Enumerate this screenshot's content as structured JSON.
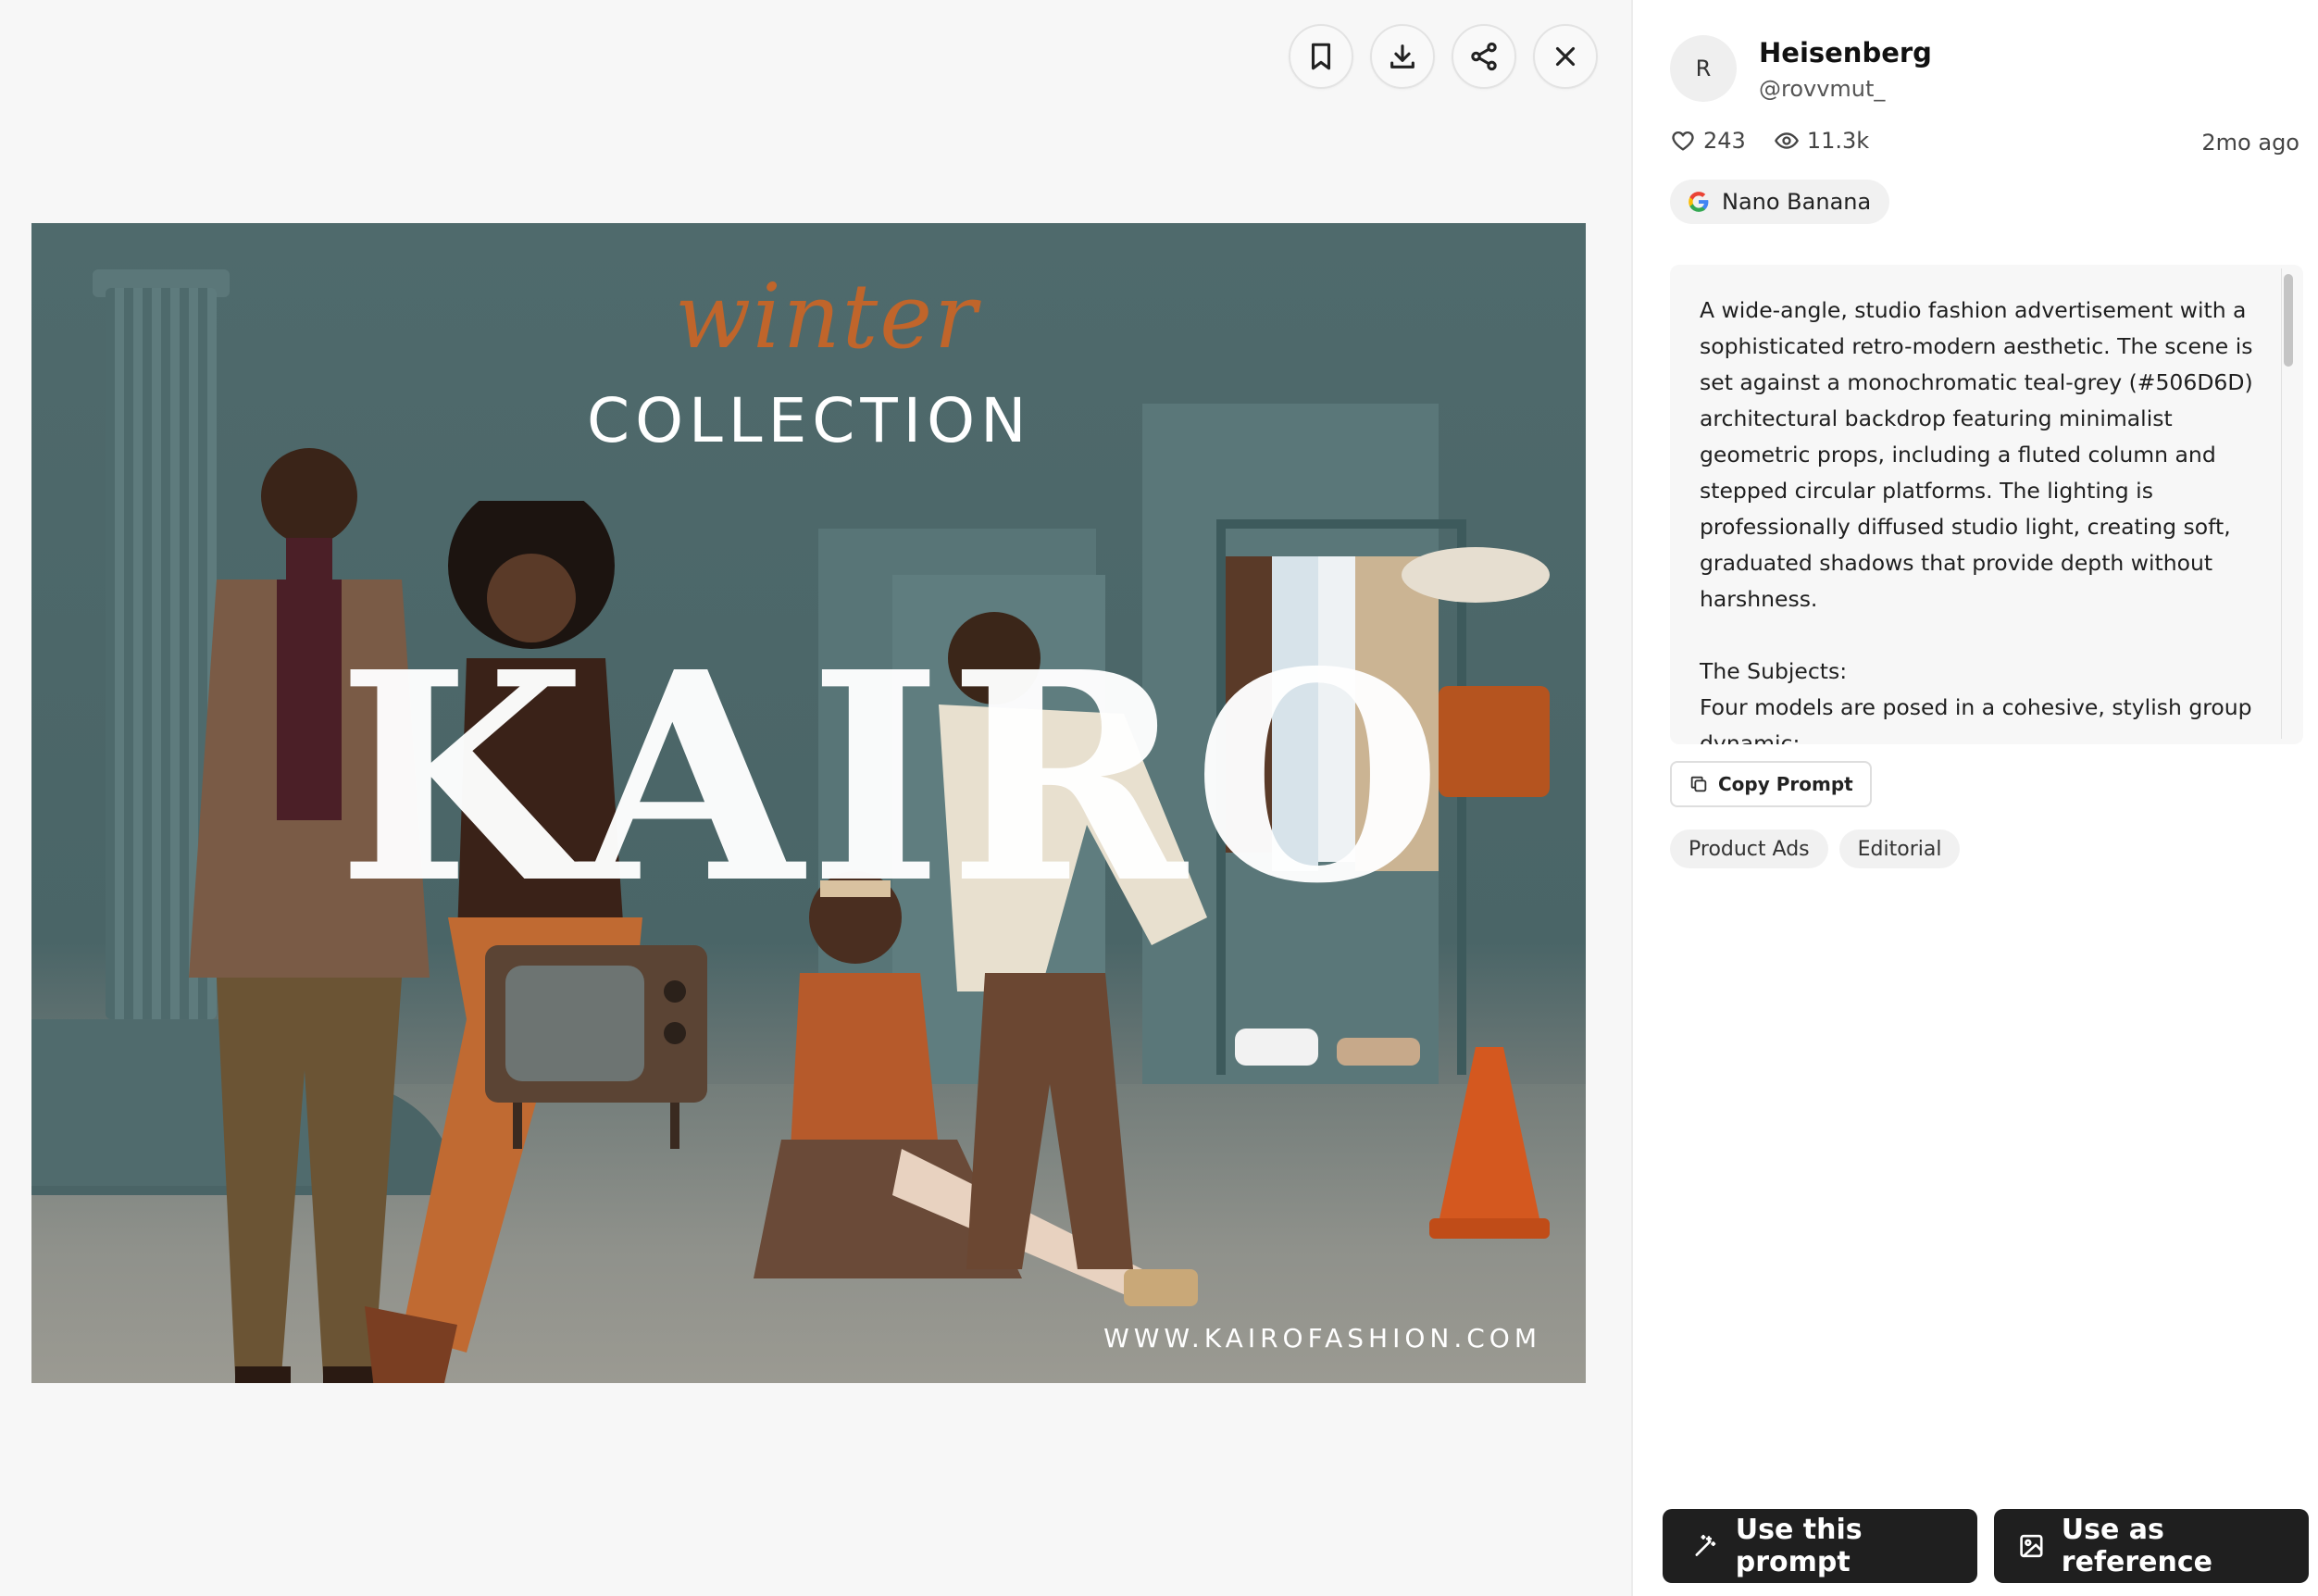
{
  "toolbar": {
    "bookmark": "bookmark-icon",
    "download": "download-icon",
    "share": "share-icon",
    "close": "close-icon"
  },
  "image": {
    "headline_script": "winter",
    "headline": "COLLECTION",
    "brand": "KAIRO",
    "website": "WWW.KAIROFASHION.COM"
  },
  "author": {
    "avatar_initial": "R",
    "name": "Heisenberg",
    "handle": "@rovvmut_"
  },
  "stats": {
    "likes": "243",
    "views": "11.3k",
    "time_ago": "2mo ago"
  },
  "model": {
    "name": "Nano Banana",
    "icon": "google-logo-icon"
  },
  "prompt": {
    "text": "A wide-angle, studio fashion advertisement with a sophisticated retro-modern aesthetic. The scene is set against a monochromatic teal-grey (#506D6D) architectural backdrop featuring minimalist geometric props, including a fluted column and stepped circular platforms. The lighting is professionally diffused studio light, creating soft, graduated shadows that provide depth without harshness.\n\nThe Subjects:\nFour models are posed in a cohesive, stylish group dynamic:",
    "copy_label": "Copy Prompt"
  },
  "tags": [
    "Product Ads",
    "Editorial"
  ],
  "actions": {
    "use_prompt": "Use this prompt",
    "use_reference": "Use as reference"
  },
  "colors": {
    "backdrop": "#506D6D",
    "accent_orange": "#c0652b",
    "button_dark": "#1f1f1f"
  }
}
